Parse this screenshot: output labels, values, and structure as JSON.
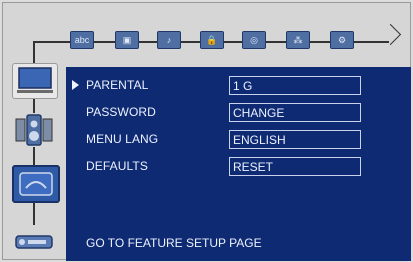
{
  "top_icons": [
    {
      "name": "language-icon",
      "glyph": "abc"
    },
    {
      "name": "video-icon",
      "glyph": "▣"
    },
    {
      "name": "audio-icon",
      "glyph": "♪"
    },
    {
      "name": "parental-lock-icon",
      "glyph": "🔒"
    },
    {
      "name": "speaker-icon",
      "glyph": "◎"
    },
    {
      "name": "channel-icon",
      "glyph": "⁂"
    },
    {
      "name": "feature-icon",
      "glyph": "⚙"
    }
  ],
  "menu": {
    "items": [
      {
        "label": "PARENTAL",
        "value": "1 G"
      },
      {
        "label": "PASSWORD",
        "value": "CHANGE"
      },
      {
        "label": "MENU LANG",
        "value": "ENGLISH"
      },
      {
        "label": "DEFAULTS",
        "value": "RESET"
      }
    ],
    "footer": "GO TO FEATURE SETUP PAGE"
  },
  "colors": {
    "panel": "#0d2a73",
    "icon": "#4f6fa3",
    "text": "#eef2ff"
  }
}
